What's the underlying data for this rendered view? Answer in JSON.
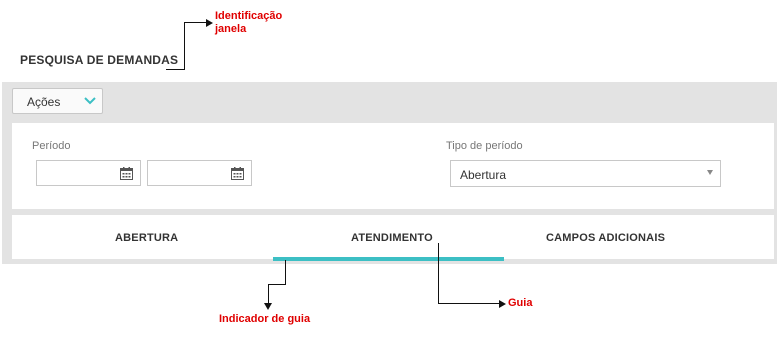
{
  "page": {
    "title": "PESQUISA DE DEMANDAS"
  },
  "annotations": {
    "window_id": "Identificação janela",
    "tab_indicator": "Indicador de guia",
    "tab": "Guia"
  },
  "actions": {
    "label": "Ações",
    "icon": "chevron-down-icon",
    "accent": "#3cbfc4"
  },
  "filters": {
    "period": {
      "label": "Período",
      "start_value": "",
      "end_value": "",
      "icon": "calendar-icon"
    },
    "period_type": {
      "label": "Tipo de período",
      "selected": "Abertura"
    }
  },
  "tabs": {
    "items": [
      {
        "label": "ABERTURA"
      },
      {
        "label": "ATENDIMENTO",
        "active": true
      },
      {
        "label": "CAMPOS ADICIONAIS"
      }
    ],
    "indicator_color": "#3cbfc4"
  },
  "colors": {
    "annotation": "#e00000",
    "panel": "#e3e3e3"
  }
}
